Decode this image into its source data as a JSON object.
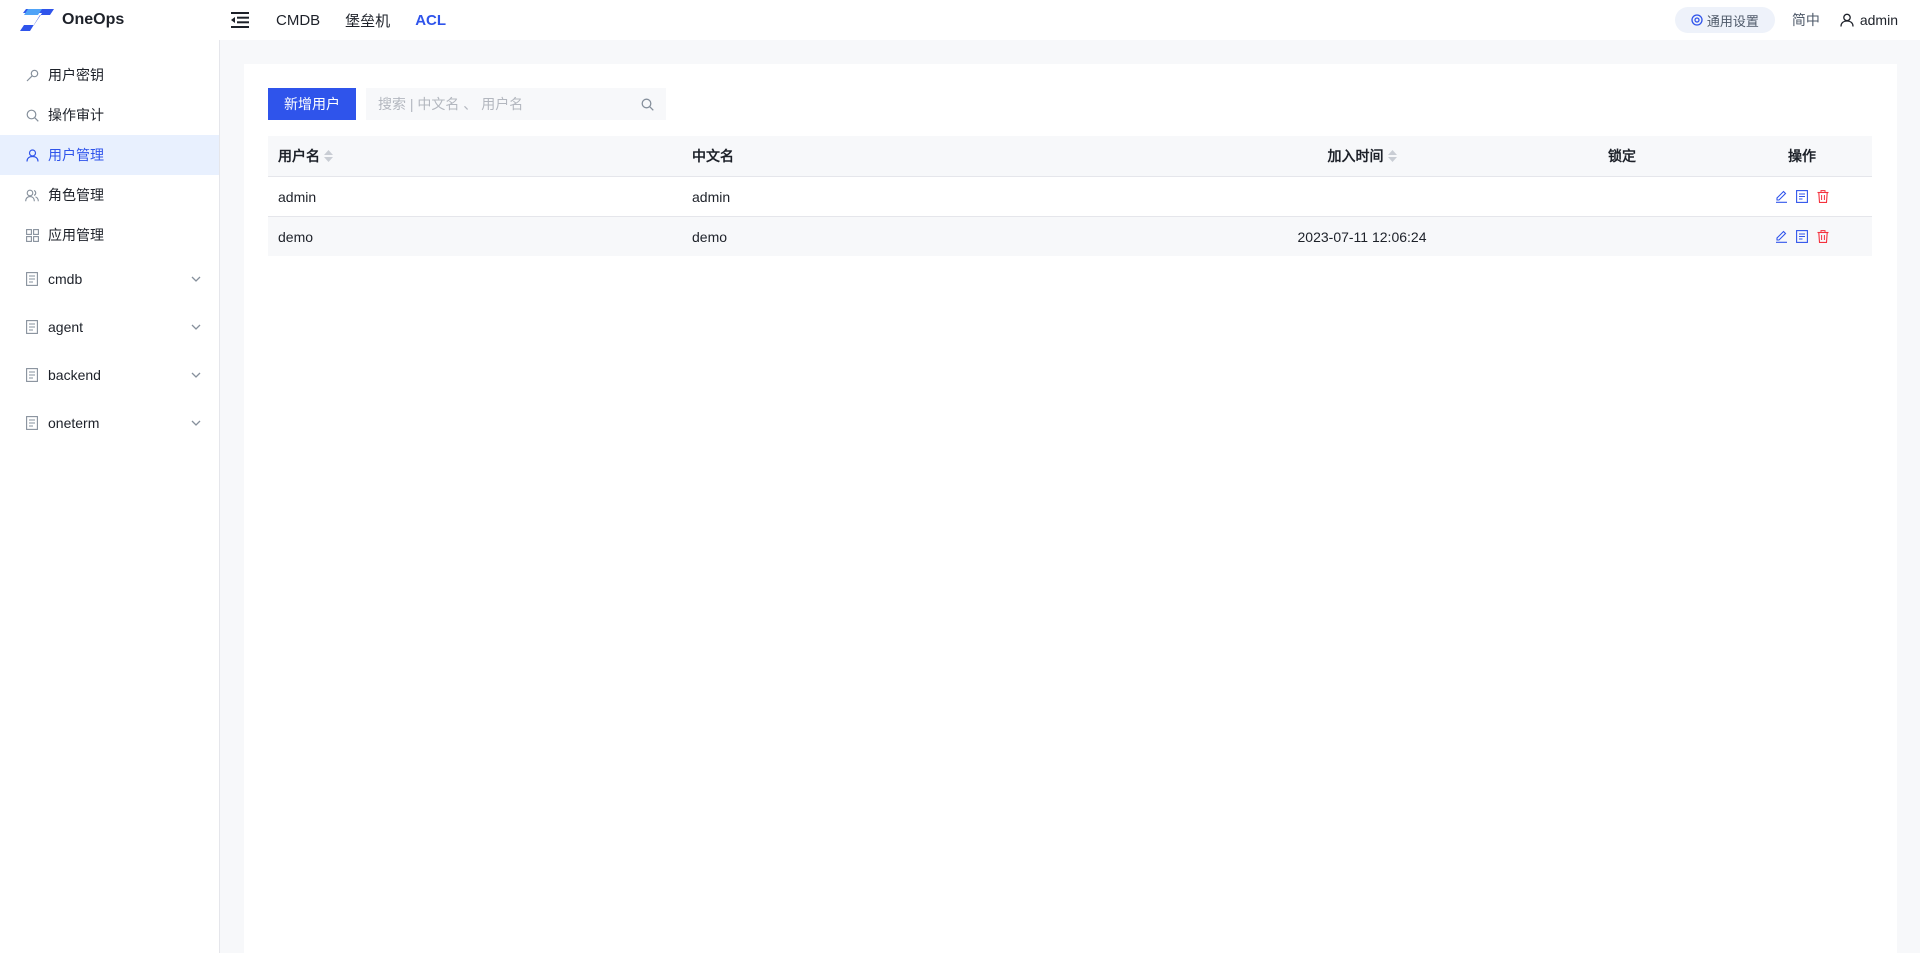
{
  "header": {
    "app_name": "OneOps",
    "nav": [
      {
        "label": "CMDB",
        "active": false
      },
      {
        "label": "堡垒机",
        "active": false
      },
      {
        "label": "ACL",
        "active": true
      }
    ],
    "settings_label": "通用设置",
    "lang_label": "简中",
    "user_name": "admin"
  },
  "sidebar": {
    "items": [
      {
        "label": "用户密钥",
        "icon": "key-icon",
        "active": false
      },
      {
        "label": "操作审计",
        "icon": "search-icon",
        "active": false
      },
      {
        "label": "用户管理",
        "icon": "user-icon",
        "active": true
      },
      {
        "label": "角色管理",
        "icon": "users-icon",
        "active": false
      },
      {
        "label": "应用管理",
        "icon": "apps-icon",
        "active": false
      }
    ],
    "groups": [
      {
        "label": "cmdb",
        "icon": "doc-icon"
      },
      {
        "label": "agent",
        "icon": "doc-icon"
      },
      {
        "label": "backend",
        "icon": "doc-icon"
      },
      {
        "label": "oneterm",
        "icon": "doc-icon"
      }
    ]
  },
  "toolbar": {
    "add_label": "新增用户",
    "search_placeholder": "搜索 | 中文名 、 用户名",
    "search_value": ""
  },
  "table": {
    "columns": {
      "username": "用户名",
      "nickname": "中文名",
      "joined": "加入时间",
      "locked": "锁定",
      "actions": "操作"
    },
    "rows": [
      {
        "username": "admin",
        "nickname": "admin",
        "joined": "",
        "locked": ""
      },
      {
        "username": "demo",
        "nickname": "demo",
        "joined": "2023-07-11 12:06:24",
        "locked": ""
      }
    ]
  },
  "colors": {
    "accent": "#2f54eb",
    "danger": "#f5313d"
  }
}
